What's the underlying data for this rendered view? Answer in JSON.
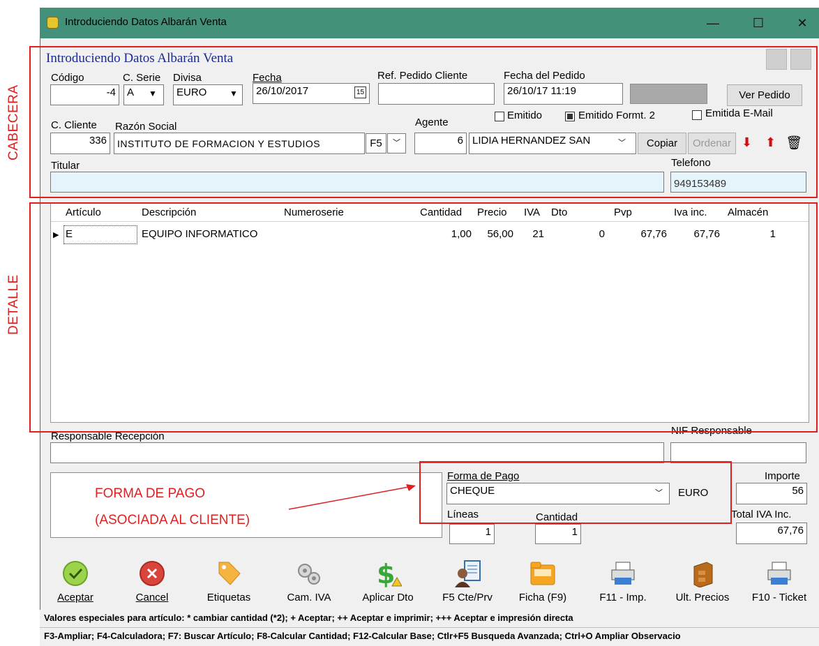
{
  "window": {
    "title": "Introduciendo Datos Albarán Venta"
  },
  "header": {
    "form_title": "Introduciendo Datos Albarán Venta",
    "codigo_label": "Código",
    "codigo_value": "-4",
    "serie_label": "C. Serie",
    "serie_value": "A",
    "divisa_label": "Divisa",
    "divisa_value": "EURO",
    "fecha_label": "Fecha",
    "fecha_value": "26/10/2017",
    "ref_label": "Ref. Pedido Cliente",
    "ref_value": "",
    "fecha_pedido_label": "Fecha del Pedido",
    "fecha_pedido_value": "26/10/17 11:19",
    "ver_pedido": "Ver Pedido",
    "emitido": "Emitido",
    "emitido_formt": "Emitido Formt. 2",
    "emitida_email": "Emitida E-Mail",
    "cliente_label": "C. Cliente",
    "cliente_value": "336",
    "razon_label": "Razón Social",
    "razon_value": "INSTITUTO DE FORMACION Y ESTUDIOS",
    "f5": "F5",
    "agente_label": "Agente",
    "agente_num": "6",
    "agente_value": "LIDIA HERNANDEZ SAN",
    "copiar": "Copiar",
    "ordenar": "Ordenar",
    "titular_label": "Titular",
    "titular_value": "",
    "telefono_label": "Telefono",
    "telefono_value": "949153489"
  },
  "grid": {
    "columns": [
      "Artículo",
      "Descripción",
      "Numeroserie",
      "Cantidad",
      "Precio",
      "IVA",
      "Dto",
      "Pvp",
      "Iva inc.",
      "Almacén"
    ],
    "rows": [
      {
        "articulo": "E",
        "descripcion": "EQUIPO INFORMATICO",
        "numeroserie": "",
        "cantidad": "1,00",
        "precio": "56,00",
        "iva": "21",
        "dto": "0",
        "pvp": "67,76",
        "iva_inc": "67,76",
        "almacen": "1"
      }
    ]
  },
  "footer": {
    "responsable_label": "Responsable Recepción",
    "nif_label": "NIF Responsable",
    "forma_pago_label": "Forma de Pago",
    "forma_pago_value": "CHEQUE",
    "currency": "EURO",
    "importe_label": "Importe",
    "importe_value": "56",
    "lineas_label": "Líneas",
    "lineas_value": "1",
    "cantidad_label": "Cantidad",
    "cantidad_value": "1",
    "total_label": "Total IVA Inc.",
    "total_value": "67,76"
  },
  "toolbar": {
    "aceptar": "Aceptar",
    "cancel": "Cancel",
    "etiquetas": "Etiquetas",
    "cam_iva": "Cam. IVA",
    "aplicar_dto": "Aplicar Dto",
    "f5_cte": "F5 Cte/Prv",
    "ficha": "Ficha (F9)",
    "f11_imp": "F11 - Imp.",
    "ult_precios": "Ult. Precios",
    "f10_ticket": "F10 - Ticket"
  },
  "status": {
    "line1": "Valores especiales para artículo: * cambiar cantidad (*2); + Aceptar; ++ Aceptar e imprimir; +++ Aceptar e impresión directa",
    "line2": "F3-Ampliar; F4-Calculadora; F7: Buscar Artículo; F8-Calcular Cantidad; F12-Calcular Base; Ctlr+F5 Busqueda Avanzada; Ctrl+O Ampliar Observacio"
  },
  "annotations": {
    "cabecera": "CABECERA",
    "detalle": "DETALLE",
    "forma_pago_1": "FORMA DE PAGO",
    "forma_pago_2": "(ASOCIADA AL CLIENTE)",
    "color": "#e02020"
  }
}
